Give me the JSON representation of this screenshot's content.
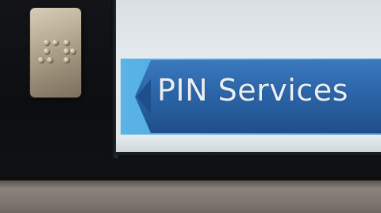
{
  "screen": {
    "button": {
      "label": "PIN Services",
      "icon": "arrow-left-icon",
      "color": "#2a63a6",
      "accent": "#4aa3d8"
    }
  },
  "hardware": {
    "braille_plate": {
      "icon": "braille-dots-icon"
    }
  }
}
